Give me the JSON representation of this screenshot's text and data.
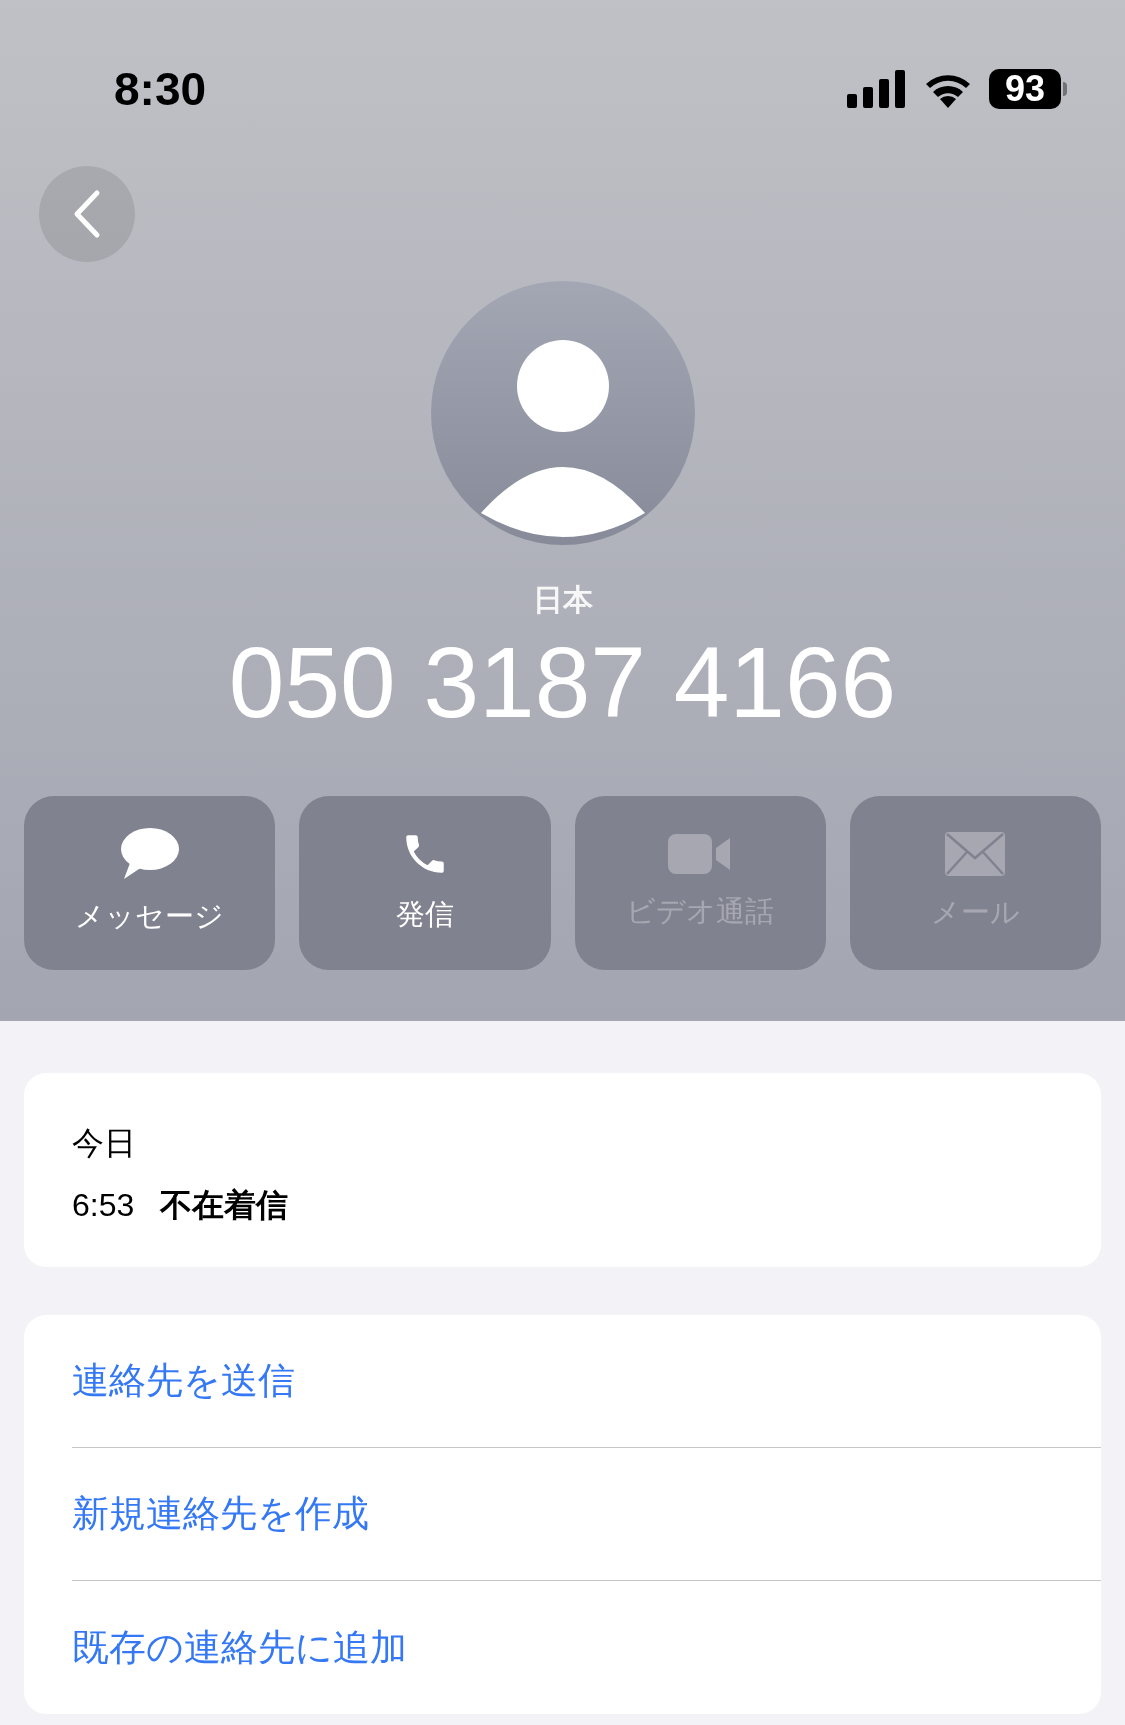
{
  "status_bar": {
    "time": "8:30",
    "battery": "93"
  },
  "header": {
    "label": "日本",
    "number": "050 3187 4166"
  },
  "actions": [
    {
      "kind": "message",
      "label": "メッセージ",
      "disabled": false
    },
    {
      "kind": "call",
      "label": "発信",
      "disabled": false
    },
    {
      "kind": "video",
      "label": "ビデオ通話",
      "disabled": true
    },
    {
      "kind": "mail",
      "label": "メール",
      "disabled": true
    }
  ],
  "recents": {
    "date": "今日",
    "time": "6:53",
    "type": "不在着信"
  },
  "options": [
    "連絡先を送信",
    "新規連絡先を作成",
    "既存の連絡先に追加"
  ]
}
